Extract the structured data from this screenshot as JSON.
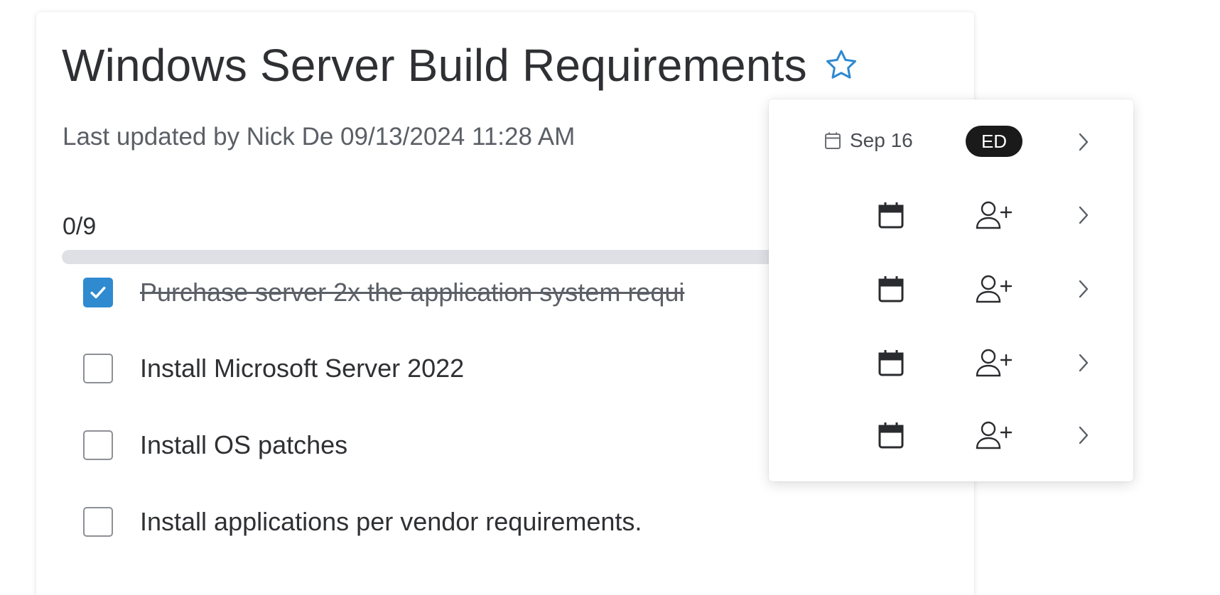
{
  "checklist": {
    "title": "Windows Server Build Requirements",
    "subtitle": "Last updated by Nick De 09/13/2024 11:28 AM",
    "progress": {
      "label": "0/9",
      "fraction": 0
    },
    "tasks": [
      {
        "text": "Purchase server 2x the application system requi",
        "checked": true
      },
      {
        "text": "Install Microsoft Server 2022",
        "checked": false
      },
      {
        "text": "Install OS patches",
        "checked": false
      },
      {
        "text": "Install applications per vendor requirements.",
        "checked": false
      }
    ]
  },
  "popover": {
    "first_row": {
      "date_label": "Sep 16",
      "assignee_initials": "ED"
    },
    "row_icons": [
      "calendar-icon",
      "add-user-icon",
      "chevron-right-icon"
    ]
  },
  "colors": {
    "accent": "#2f8ad0",
    "track": "#dfe0e6",
    "avatar_bg": "#1a1a1a"
  }
}
